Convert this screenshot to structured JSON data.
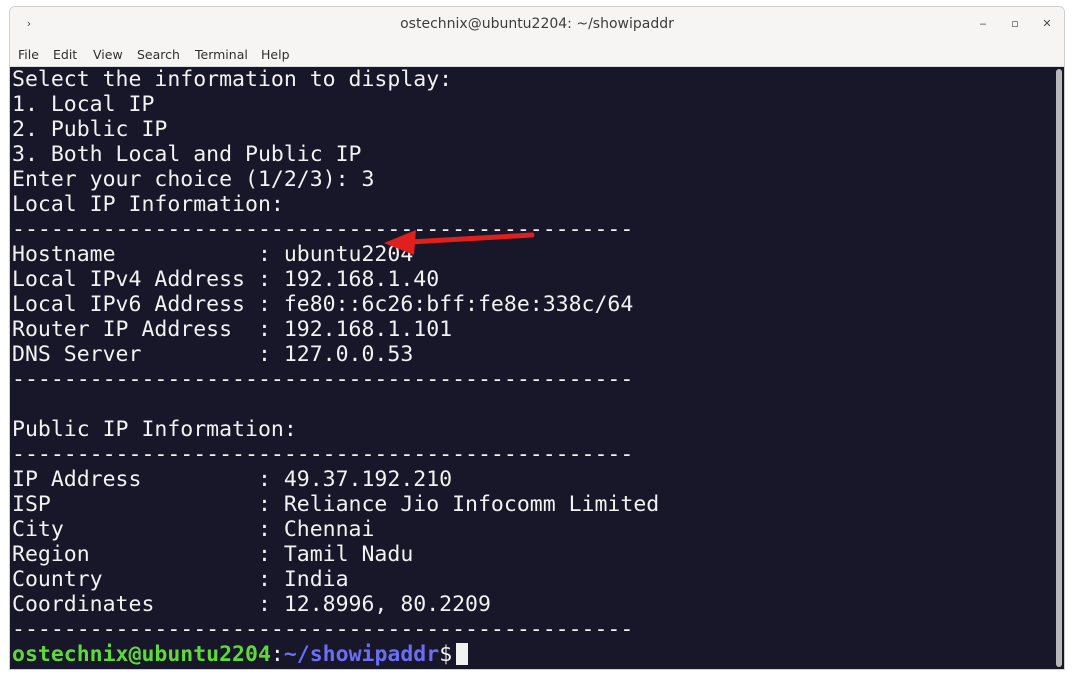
{
  "window": {
    "title": "ostechnix@ubuntu2204: ~/showipaddr",
    "menu_icon": "›",
    "minimize_glyph": "‒",
    "maximize_glyph": "▫",
    "close_glyph": "✕"
  },
  "menu": {
    "items": [
      "File",
      "Edit",
      "View",
      "Search",
      "Terminal",
      "Help"
    ]
  },
  "terminal": {
    "lines": [
      "Select the information to display:",
      "1. Local IP",
      "2. Public IP",
      "3. Both Local and Public IP",
      "Enter your choice (1/2/3): 3",
      "Local IP Information:",
      "------------------------------------------------",
      "Hostname           : ubuntu2204",
      "Local IPv4 Address : 192.168.1.40",
      "Local IPv6 Address : fe80::6c26:bff:fe8e:338c/64",
      "Router IP Address  : 192.168.1.101",
      "DNS Server         : 127.0.0.53",
      "------------------------------------------------",
      "",
      "Public IP Information:",
      "------------------------------------------------",
      "IP Address         : 49.37.192.210",
      "ISP                : Reliance Jio Infocomm Limited",
      "City               : Chennai",
      "Region             : Tamil Nadu",
      "Country            : India",
      "Coordinates        : 12.8996, 80.2209",
      "------------------------------------------------"
    ],
    "prompt": {
      "user_host": "ostechnix@ubuntu2204",
      "colon": ":",
      "path": "~/showipaddr",
      "symbol": "$"
    }
  },
  "colors": {
    "terminal_bg": "#181629",
    "text": "#f2f2f2",
    "prompt_user": "#5dd93a",
    "prompt_path": "#6b6ef5",
    "annotation_arrow": "#e0201c"
  },
  "annotation": {
    "icon": "red-arrow-icon"
  }
}
